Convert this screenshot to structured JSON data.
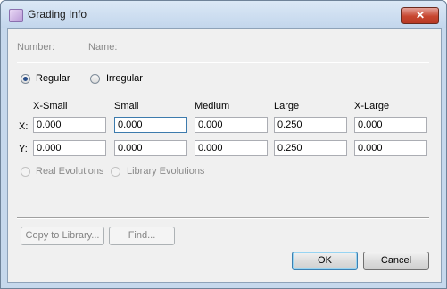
{
  "window": {
    "title": "Grading Info",
    "close_glyph": "✕",
    "icon": "app-icon"
  },
  "info": {
    "number_label": "Number:",
    "name_label": "Name:"
  },
  "grading_type": {
    "options": [
      {
        "label": "Regular",
        "checked": true
      },
      {
        "label": "Irregular",
        "checked": false
      }
    ]
  },
  "grid": {
    "columns": [
      "X-Small",
      "Small",
      "Medium",
      "Large",
      "X-Large"
    ],
    "rows": [
      {
        "label": "X:",
        "values": [
          "0.000",
          "0.000",
          "0.000",
          "0.250",
          "0.000"
        ]
      },
      {
        "label": "Y:",
        "values": [
          "0.000",
          "0.000",
          "0.000",
          "0.250",
          "0.000"
        ]
      }
    ]
  },
  "evolutions": {
    "options": [
      {
        "label": "Real Evolutions",
        "enabled": false
      },
      {
        "label": "Library Evolutions",
        "enabled": false
      }
    ]
  },
  "buttons": {
    "copy_to_library": "Copy to Library...",
    "find": "Find...",
    "ok": "OK",
    "cancel": "Cancel"
  }
}
